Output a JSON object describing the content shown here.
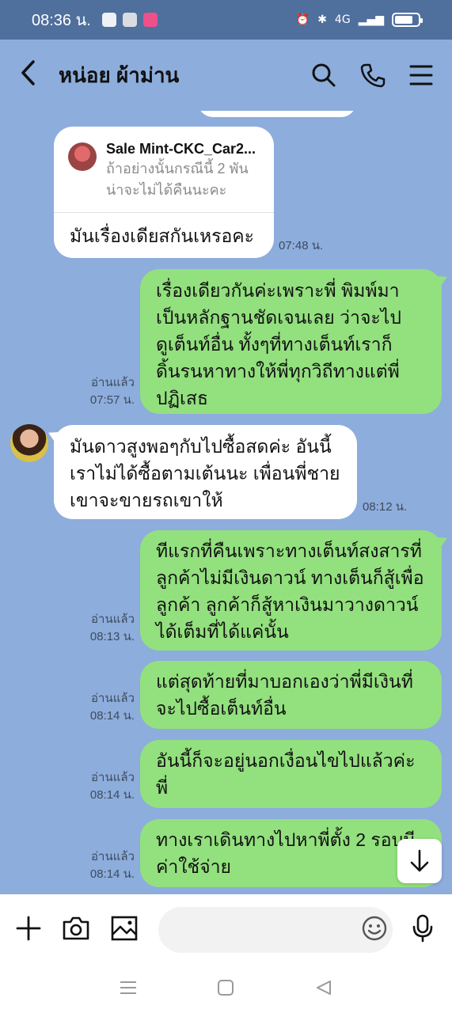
{
  "status_bar": {
    "time": "08:36 น.",
    "network": "4G"
  },
  "header": {
    "title": "หน่อย ผ้าม่าน"
  },
  "messages": {
    "m1": {
      "reply_name": "Sale Mint-CKC_Car2...",
      "reply_text_1": "ถ้าอย่างนั้นกรณีนี้ 2 พัน",
      "reply_text_2": "น่าจะไม่ได้คืนนะคะ",
      "text": "มันเรื่องเดียสกันเหรอคะ",
      "time": "07:48 น."
    },
    "m2": {
      "lines": [
        "เรื่องเดียวกันค่ะเพราะพี่ พิมพ์มา",
        "เป็นหลักฐานชัดเจนเลย ว่าจะไป",
        "ดูเต็นท์อื่น ทั้งๆที่ทางเต็นท์เราก็",
        "ดิ้นรนหาทางให้พี่ทุกวิถีทางแต่พี่",
        "ปฏิเสธ"
      ],
      "read": "อ่านแล้ว",
      "time": "07:57 น."
    },
    "m3": {
      "lines": [
        "มันดาวสูงพอๆกับไปซื้อสดค่ะ อันนี้",
        "เราไม่ได้ซื้อตามเต้นนะ เพื่อนพี่ชาย",
        "เขาจะขายรถเขาให้"
      ],
      "time": "08:12 น."
    },
    "m4": {
      "lines": [
        "ทีแรกที่คืนเพราะทางเต็นท์สงสารที่",
        "ลูกค้าไม่มีเงินดาวน์ ทางเต็นก็สู้เพื่อ",
        "ลูกค้า ลูกค้าก็สู้หาเงินมาวางดาวน์",
        "ได้เต็มที่ได้แค่นั้น"
      ],
      "read": "อ่านแล้ว",
      "time": "08:13 น."
    },
    "m5": {
      "lines": [
        "แต่สุดท้ายที่มาบอกเองว่าพี่มีเงินที่",
        "จะไปซื้อเต็นท์อื่น"
      ],
      "read": "อ่านแล้ว",
      "time": "08:14 น."
    },
    "m6": {
      "lines": [
        "อันนี้ก็จะอยู่นอกเงื่อนไขไปแล้วค่ะ",
        "พี่"
      ],
      "read": "อ่านแล้ว",
      "time": "08:14 น."
    },
    "m7": {
      "lines": [
        "ทางเราเดินทางไปหาพี่ตั้ง 2 รอบมี",
        "ค่าใช้จ่าย"
      ],
      "read": "อ่านแล้ว",
      "time": "08:14 น."
    }
  },
  "input": {
    "placeholder": ""
  },
  "icons": {
    "back": "chevron-left-icon",
    "search": "search-icon",
    "call": "phone-icon",
    "menu": "menu-icon",
    "plus": "plus-icon",
    "camera": "camera-icon",
    "image": "image-icon",
    "emoji": "emoji-icon",
    "mic": "microphone-icon",
    "scroll": "arrow-down-icon"
  },
  "colors": {
    "chat_bg": "#8daddc",
    "outgoing": "#93e07e",
    "incoming": "#ffffff",
    "status_bar": "#4f6f9d"
  }
}
